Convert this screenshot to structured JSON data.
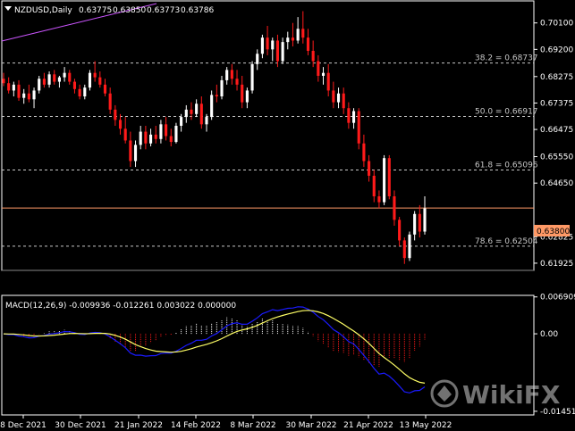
{
  "header": {
    "symbol": "NZDUSD,Daily",
    "open": "0.63775",
    "high": "0.63850",
    "low": "0.63773",
    "close": "0.63786"
  },
  "current_price_label": "0.63800",
  "macd_label": "MACD(12,26,9) -0.009936 -0.012261 0.003022 0.000000",
  "watermark": "WikiFX",
  "colors": {
    "background": "#000000",
    "bull": "#ffffff",
    "bear": "#ff1a1a",
    "price_line": "#ff9966",
    "fib_line": "#c8c8c8",
    "macd_line": "#1a1aff",
    "signal_line": "#ffff66",
    "trend_line": "#cc55ff"
  },
  "chart_data": [
    {
      "type": "candlestick",
      "title": "NZDUSD,Daily",
      "y_ticks": [
        "0.70100",
        "0.69200",
        "0.68275",
        "0.67375",
        "0.66475",
        "0.65550",
        "0.64650",
        "0.63800",
        "0.62825",
        "0.61925"
      ],
      "ylim": [
        0.6168,
        0.7085
      ],
      "x_ticks": [
        "8 Dec 2021",
        "30 Dec 2021",
        "21 Jan 2022",
        "14 Feb 2022",
        "8 Mar 2022",
        "30 Mar 2022",
        "21 Apr 2022",
        "13 May 2022"
      ],
      "fib_levels": [
        {
          "label": "38.2 = 0.68737",
          "value": 0.68737
        },
        {
          "label": "50.0 = 0.66917",
          "value": 0.66917
        },
        {
          "label": "61.8 = 0.65096",
          "value": 0.65096
        },
        {
          "label": "78.6 = 0.62504",
          "value": 0.62504
        }
      ],
      "current_price": 0.638,
      "candles": [
        [
          0.682,
          0.684,
          0.6795,
          0.6805
        ],
        [
          0.6805,
          0.6825,
          0.677,
          0.678
        ],
        [
          0.678,
          0.681,
          0.676,
          0.68
        ],
        [
          0.68,
          0.6815,
          0.6745,
          0.6755
        ],
        [
          0.6755,
          0.6785,
          0.6735,
          0.677
        ],
        [
          0.677,
          0.68,
          0.674,
          0.675
        ],
        [
          0.675,
          0.679,
          0.672,
          0.678
        ],
        [
          0.678,
          0.683,
          0.677,
          0.682
        ],
        [
          0.682,
          0.684,
          0.679,
          0.68
        ],
        [
          0.68,
          0.6845,
          0.679,
          0.6835
        ],
        [
          0.6835,
          0.685,
          0.68,
          0.681
        ],
        [
          0.681,
          0.683,
          0.679,
          0.6825
        ],
        [
          0.6825,
          0.686,
          0.681,
          0.684
        ],
        [
          0.684,
          0.685,
          0.68,
          0.681
        ],
        [
          0.681,
          0.682,
          0.677,
          0.6785
        ],
        [
          0.6785,
          0.68,
          0.675,
          0.676
        ],
        [
          0.676,
          0.68,
          0.675,
          0.679
        ],
        [
          0.679,
          0.685,
          0.678,
          0.684
        ],
        [
          0.684,
          0.688,
          0.681,
          0.6825
        ],
        [
          0.6825,
          0.6845,
          0.679,
          0.68
        ],
        [
          0.68,
          0.682,
          0.676,
          0.677
        ],
        [
          0.677,
          0.679,
          0.67,
          0.6715
        ],
        [
          0.6715,
          0.673,
          0.666,
          0.668
        ],
        [
          0.668,
          0.67,
          0.663,
          0.665
        ],
        [
          0.665,
          0.669,
          0.66,
          0.661
        ],
        [
          0.661,
          0.664,
          0.652,
          0.654
        ],
        [
          0.654,
          0.661,
          0.652,
          0.6595
        ],
        [
          0.6595,
          0.666,
          0.658,
          0.664
        ],
        [
          0.664,
          0.666,
          0.658,
          0.66
        ],
        [
          0.66,
          0.665,
          0.659,
          0.663
        ],
        [
          0.663,
          0.666,
          0.66,
          0.6615
        ],
        [
          0.6615,
          0.668,
          0.66,
          0.6665
        ],
        [
          0.6665,
          0.669,
          0.661,
          0.6625
        ],
        [
          0.6625,
          0.665,
          0.659,
          0.6605
        ],
        [
          0.6605,
          0.667,
          0.66,
          0.666
        ],
        [
          0.666,
          0.67,
          0.664,
          0.669
        ],
        [
          0.669,
          0.673,
          0.667,
          0.6715
        ],
        [
          0.6715,
          0.674,
          0.668,
          0.67
        ],
        [
          0.67,
          0.675,
          0.669,
          0.6735
        ],
        [
          0.6735,
          0.676,
          0.665,
          0.6665
        ],
        [
          0.6665,
          0.67,
          0.664,
          0.669
        ],
        [
          0.669,
          0.678,
          0.668,
          0.6765
        ],
        [
          0.6765,
          0.68,
          0.674,
          0.676
        ],
        [
          0.676,
          0.683,
          0.675,
          0.6815
        ],
        [
          0.6815,
          0.686,
          0.68,
          0.685
        ],
        [
          0.685,
          0.687,
          0.68,
          0.682
        ],
        [
          0.682,
          0.685,
          0.678,
          0.68
        ],
        [
          0.68,
          0.683,
          0.672,
          0.674
        ],
        [
          0.674,
          0.679,
          0.672,
          0.678
        ],
        [
          0.678,
          0.688,
          0.677,
          0.687
        ],
        [
          0.687,
          0.692,
          0.685,
          0.6905
        ],
        [
          0.6905,
          0.697,
          0.689,
          0.696
        ],
        [
          0.696,
          0.7,
          0.69,
          0.692
        ],
        [
          0.692,
          0.696,
          0.688,
          0.695
        ],
        [
          0.695,
          0.697,
          0.686,
          0.688
        ],
        [
          0.688,
          0.696,
          0.687,
          0.6945
        ],
        [
          0.6945,
          0.698,
          0.692,
          0.696
        ],
        [
          0.696,
          0.701,
          0.693,
          0.695
        ],
        [
          0.695,
          0.703,
          0.694,
          0.699
        ],
        [
          0.699,
          0.705,
          0.694,
          0.696
        ],
        [
          0.696,
          0.699,
          0.69,
          0.6915
        ],
        [
          0.6915,
          0.695,
          0.686,
          0.688
        ],
        [
          0.688,
          0.69,
          0.681,
          0.683
        ],
        [
          0.683,
          0.686,
          0.68,
          0.684
        ],
        [
          0.684,
          0.687,
          0.676,
          0.678
        ],
        [
          0.678,
          0.681,
          0.672,
          0.674
        ],
        [
          0.674,
          0.679,
          0.672,
          0.677
        ],
        [
          0.677,
          0.679,
          0.67,
          0.672
        ],
        [
          0.672,
          0.674,
          0.665,
          0.667
        ],
        [
          0.667,
          0.672,
          0.665,
          0.671
        ],
        [
          0.671,
          0.672,
          0.658,
          0.66
        ],
        [
          0.66,
          0.663,
          0.652,
          0.654
        ],
        [
          0.654,
          0.656,
          0.647,
          0.649
        ],
        [
          0.649,
          0.651,
          0.64,
          0.642
        ],
        [
          0.642,
          0.644,
          0.638,
          0.64
        ],
        [
          0.64,
          0.656,
          0.639,
          0.655
        ],
        [
          0.655,
          0.656,
          0.641,
          0.642
        ],
        [
          0.642,
          0.644,
          0.632,
          0.634
        ],
        [
          0.634,
          0.635,
          0.625,
          0.627
        ],
        [
          0.627,
          0.628,
          0.619,
          0.621
        ],
        [
          0.621,
          0.63,
          0.62,
          0.629
        ],
        [
          0.629,
          0.637,
          0.627,
          0.636
        ],
        [
          0.636,
          0.639,
          0.628,
          0.63
        ],
        [
          0.63,
          0.642,
          0.629,
          0.6379
        ]
      ]
    },
    {
      "type": "macd",
      "title": "MACD(12,26,9)",
      "values": {
        "macd": -0.009936,
        "signal": -0.012261,
        "histogram": 0.003022,
        "extra": 0.0
      },
      "y_ticks": [
        "0.006909",
        "0.00",
        "-0.014514"
      ],
      "ylim": [
        -0.0152,
        0.0072
      ]
    }
  ]
}
